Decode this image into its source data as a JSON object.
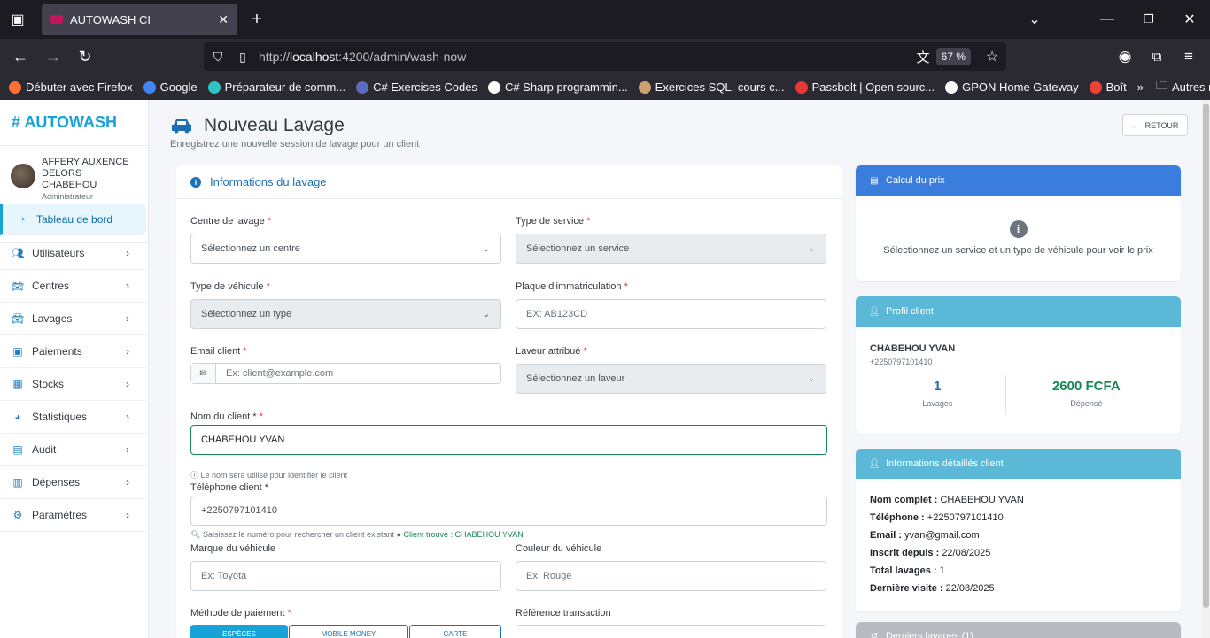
{
  "browser": {
    "tab_title": "AUTOWASH CI",
    "url_prefix": "http://",
    "url_host": "localhost",
    "url_rest": ":4200/admin/wash-now",
    "zoom": "67 %",
    "bookmarks": [
      {
        "label": "Débuter avec Firefox",
        "color": "#ff7139"
      },
      {
        "label": "Google",
        "color": "#4285f4"
      },
      {
        "label": "Préparateur de comm...",
        "color": "#2ec4c4"
      },
      {
        "label": "C# Exercises Codes",
        "color": "#5c6bc0"
      },
      {
        "label": "C# Sharp programmin...",
        "color": "#ffffff"
      },
      {
        "label": "Exercices SQL, cours c...",
        "color": "#d0a070"
      },
      {
        "label": "Passbolt | Open sourc...",
        "color": "#e53935"
      },
      {
        "label": "GPON Home Gateway",
        "color": "#fbfbfe"
      },
      {
        "label": "Boît",
        "color": "#ea4335"
      }
    ],
    "other_bookmarks": "Autres marque-pages"
  },
  "sidebar": {
    "brand": "# AUTOWASH",
    "user_name": "AFFERY AUXENCE DELORS CHABEHOU",
    "user_role": "Administrateur",
    "items": [
      {
        "label": "Tableau de bord",
        "icon": "dashboard-icon"
      },
      {
        "label": "Utilisateurs",
        "icon": "users-icon"
      },
      {
        "label": "Centres",
        "icon": "car-icon"
      },
      {
        "label": "Lavages",
        "icon": "car-icon"
      },
      {
        "label": "Paiements",
        "icon": "money-icon"
      },
      {
        "label": "Stocks",
        "icon": "boxes-icon"
      },
      {
        "label": "Statistiques",
        "icon": "chart-pie-icon"
      },
      {
        "label": "Audit",
        "icon": "clipboard-check-icon"
      },
      {
        "label": "Dépenses",
        "icon": "receipt-icon"
      },
      {
        "label": "Paramètres",
        "icon": "cogs-icon"
      }
    ]
  },
  "page": {
    "title": "Nouveau Lavage",
    "subtitle": "Enregistrez une nouvelle session de lavage pour un client",
    "back_label": "RETOUR"
  },
  "form": {
    "card_title": "Informations du lavage",
    "centre_label": "Centre de lavage",
    "centre_value": "Sélectionnez un centre",
    "service_label": "Type de service",
    "service_value": "Sélectionnez un service",
    "vehicle_label": "Type de véhicule",
    "vehicle_value": "Sélectionnez un type",
    "plate_label": "Plaque d'immatriculation",
    "plate_placeholder": "EX: AB123CD",
    "email_label": "Email client",
    "email_placeholder": "Ex: client@example.com",
    "washer_label": "Laveur attribué",
    "washer_value": "Sélectionnez un laveur",
    "name_label": "Nom du client *",
    "name_value": "CHABEHOU YVAN",
    "name_hint": "Le nom sera utilisé pour identifier le client",
    "phone_label": "Téléphone client *",
    "phone_value": "+2250797101410",
    "phone_hint": "Saisissez le numéro pour rechercher un client existant",
    "phone_found": "Client trouvé : CHABEHOU YVAN",
    "brand_label": "Marque du véhicule",
    "brand_placeholder": "Ex: Toyota",
    "color_label": "Couleur du véhicule",
    "color_placeholder": "Ex: Rouge",
    "payment_label": "Méthode de paiement",
    "payment_options": [
      "ESPÈCES",
      "MOBILE MONEY",
      "CARTE"
    ],
    "reference_label": "Référence transaction",
    "required_mark": "*"
  },
  "price_card": {
    "title": "Calcul du prix",
    "message": "Sélectionnez un service et un type de véhicule pour voir le prix"
  },
  "profile_card": {
    "title": "Profil client",
    "name": "CHABEHOU YVAN",
    "phone": "+2250797101410",
    "washes_value": "1",
    "washes_label": "Lavages",
    "spent_value": "2600 FCFA",
    "spent_label": "Dépensé"
  },
  "details_card": {
    "title": "Informations détaillés client",
    "rows": [
      {
        "label": "Nom complet :",
        "value": "CHABEHOU YVAN"
      },
      {
        "label": "Téléphone :",
        "value": "+2250797101410"
      },
      {
        "label": "Email :",
        "value": "yvan@gmail.com"
      },
      {
        "label": "Inscrit depuis :",
        "value": "22/08/2025"
      },
      {
        "label": "Total lavages :",
        "value": "1"
      },
      {
        "label": "Dernière visite :",
        "value": "22/08/2025"
      }
    ]
  },
  "last_washes_card": {
    "title": "Derniers lavages (1)"
  },
  "colors": {
    "brand": "#17a2d8",
    "primary": "#1f6fb5",
    "success": "#198754",
    "danger": "#dc3545"
  }
}
